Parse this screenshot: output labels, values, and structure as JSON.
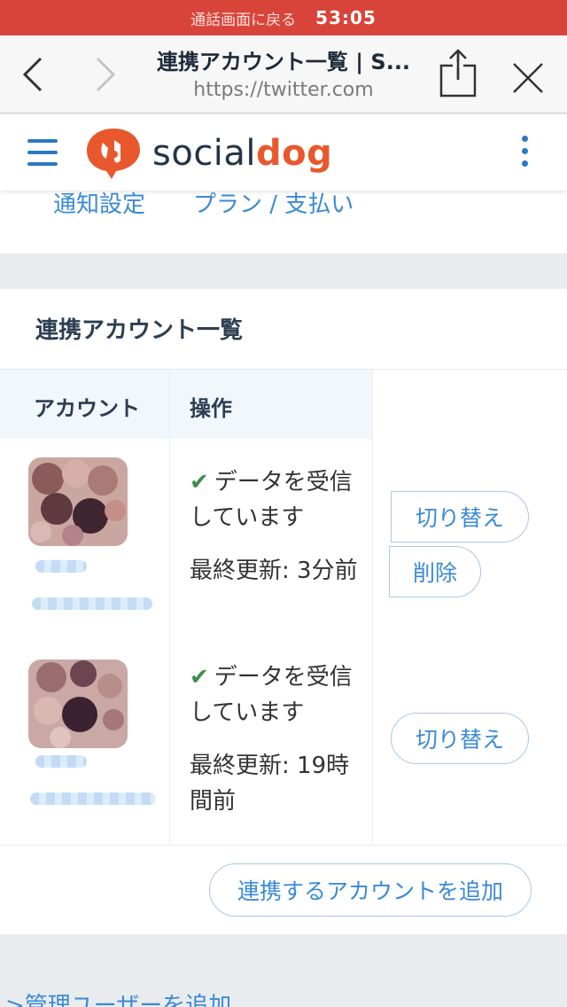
{
  "status_bar": {
    "call_text": "通話画面に戻る",
    "time": "53:05"
  },
  "browser": {
    "page_title": "連携アカウント一覧 | S...",
    "url": "https://twitter.com"
  },
  "app": {
    "brand_part1": "social",
    "brand_part2": "dog",
    "brand_color": "#e8582c"
  },
  "top_links": [
    "通知設定",
    "プラン / 支払い"
  ],
  "accounts_card": {
    "title": "連携アカウント一覧",
    "columns": [
      "アカウント",
      "操作"
    ],
    "rows": [
      {
        "status": "データを受信しています",
        "updated": "最終更新: 3分前",
        "actions": [
          "切り替え",
          "削除"
        ]
      },
      {
        "status": "データを受信しています",
        "updated": "最終更新: 19時間前",
        "actions": [
          "切り替え"
        ]
      }
    ],
    "add_button": "連携するアカウントを追加"
  },
  "footer": {
    "partial_link": "管理ユーザーを追加"
  }
}
